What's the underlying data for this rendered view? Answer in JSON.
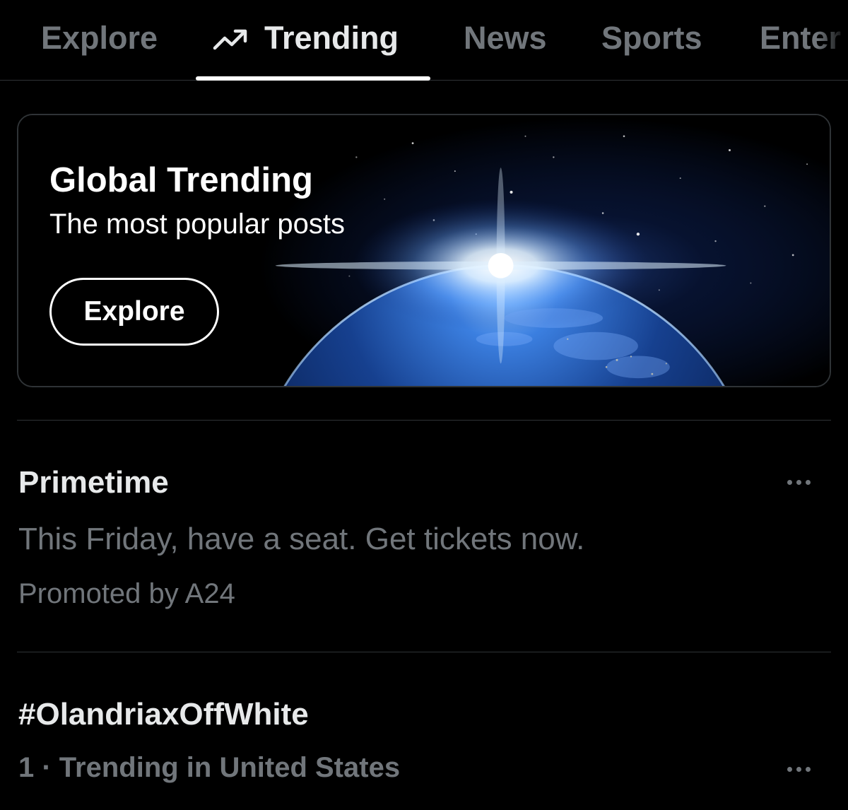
{
  "tabs": {
    "explore": "Explore",
    "trending": "Trending",
    "news": "News",
    "sports": "Sports",
    "entertainment": "Enter",
    "active": "trending"
  },
  "hero": {
    "title": "Global Trending",
    "subtitle": "The most popular posts",
    "button_label": "Explore",
    "image": "earth-from-space-sunrise"
  },
  "trends": [
    {
      "title": "Primetime",
      "description": "This Friday, have a seat. Get tickets now.",
      "meta": "Promoted by A24",
      "promoted": true
    },
    {
      "title": "#OlandriaxOffWhite",
      "meta": "1 · Trending in United States",
      "promoted": false
    }
  ],
  "icons": {
    "trending": "trending-up-icon",
    "more": "more-horizontal-icon"
  },
  "colors": {
    "background": "#000000",
    "primary_text": "#e7e9ea",
    "secondary_text": "#71767b",
    "divider": "#2f3336",
    "accent": "#ffffff"
  }
}
